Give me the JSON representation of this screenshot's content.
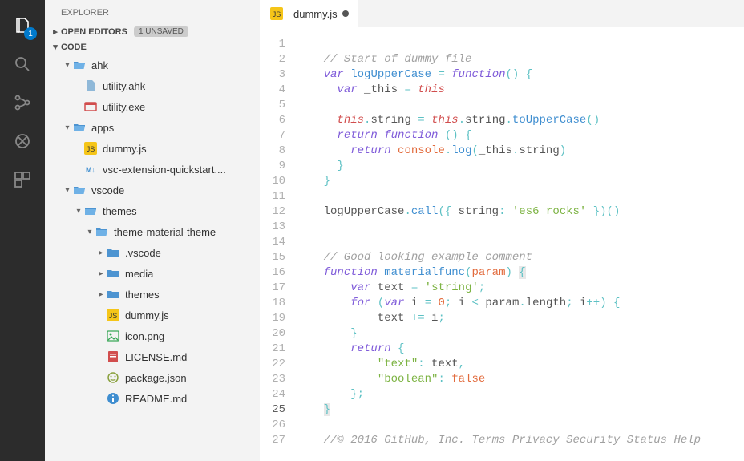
{
  "activity": {
    "badge_count": "1",
    "items": [
      "files-icon",
      "search-icon",
      "scm-icon",
      "debug-icon",
      "extensions-icon"
    ]
  },
  "sidebar": {
    "title": "EXPLORER",
    "open_editors": {
      "label": "OPEN EDITORS",
      "unsaved": "1 UNSAVED"
    },
    "root": {
      "label": "CODE"
    },
    "tree": [
      {
        "indent": 1,
        "twisty": "▾",
        "icon": "folder-open",
        "label": "ahk"
      },
      {
        "indent": 2,
        "twisty": "",
        "icon": "file",
        "label": "utility.ahk"
      },
      {
        "indent": 2,
        "twisty": "",
        "icon": "exe",
        "label": "utility.exe"
      },
      {
        "indent": 1,
        "twisty": "▾",
        "icon": "folder-open",
        "label": "apps"
      },
      {
        "indent": 2,
        "twisty": "",
        "icon": "js",
        "label": "dummy.js"
      },
      {
        "indent": 2,
        "twisty": "",
        "icon": "md-alt",
        "label": "vsc-extension-quickstart...."
      },
      {
        "indent": 1,
        "twisty": "▾",
        "icon": "folder-open",
        "label": "vscode"
      },
      {
        "indent": 2,
        "twisty": "▾",
        "icon": "folder-open",
        "label": "themes"
      },
      {
        "indent": 3,
        "twisty": "▾",
        "icon": "folder-open",
        "label": "theme-material-theme"
      },
      {
        "indent": 4,
        "twisty": "▸",
        "icon": "folder",
        "label": ".vscode"
      },
      {
        "indent": 4,
        "twisty": "▸",
        "icon": "folder",
        "label": "media"
      },
      {
        "indent": 4,
        "twisty": "▸",
        "icon": "folder",
        "label": "themes"
      },
      {
        "indent": 4,
        "twisty": "",
        "icon": "js",
        "label": "dummy.js"
      },
      {
        "indent": 4,
        "twisty": "",
        "icon": "image",
        "label": "icon.png"
      },
      {
        "indent": 4,
        "twisty": "",
        "icon": "license",
        "label": "LICENSE.md"
      },
      {
        "indent": 4,
        "twisty": "",
        "icon": "json",
        "label": "package.json"
      },
      {
        "indent": 4,
        "twisty": "",
        "icon": "info",
        "label": "README.md"
      }
    ]
  },
  "tabs": [
    {
      "icon": "js",
      "label": "dummy.js",
      "dirty": true
    }
  ],
  "code": {
    "lines": 27,
    "current_line": 25,
    "tokens": [
      [],
      [
        {
          "c": "c-comment",
          "t": "    // Start of dummy file"
        }
      ],
      [
        {
          "c": "c-norm",
          "t": "    "
        },
        {
          "c": "c-kw",
          "t": "var"
        },
        {
          "c": "c-norm",
          "t": " "
        },
        {
          "c": "c-fn",
          "t": "logUpperCase"
        },
        {
          "c": "c-norm",
          "t": " "
        },
        {
          "c": "c-op",
          "t": "="
        },
        {
          "c": "c-norm",
          "t": " "
        },
        {
          "c": "c-kw",
          "t": "function"
        },
        {
          "c": "c-punc",
          "t": "()"
        },
        {
          "c": "c-norm",
          "t": " "
        },
        {
          "c": "c-punc",
          "t": "{"
        }
      ],
      [
        {
          "c": "c-norm",
          "t": "      "
        },
        {
          "c": "c-kw",
          "t": "var"
        },
        {
          "c": "c-norm",
          "t": " _this "
        },
        {
          "c": "c-op",
          "t": "="
        },
        {
          "c": "c-norm",
          "t": " "
        },
        {
          "c": "c-this",
          "t": "this"
        }
      ],
      [],
      [
        {
          "c": "c-norm",
          "t": "      "
        },
        {
          "c": "c-this",
          "t": "this"
        },
        {
          "c": "c-punc",
          "t": "."
        },
        {
          "c": "c-id",
          "t": "string"
        },
        {
          "c": "c-norm",
          "t": " "
        },
        {
          "c": "c-op",
          "t": "="
        },
        {
          "c": "c-norm",
          "t": " "
        },
        {
          "c": "c-this",
          "t": "this"
        },
        {
          "c": "c-punc",
          "t": "."
        },
        {
          "c": "c-id",
          "t": "string"
        },
        {
          "c": "c-punc",
          "t": "."
        },
        {
          "c": "c-fn",
          "t": "toUpperCase"
        },
        {
          "c": "c-punc",
          "t": "()"
        }
      ],
      [
        {
          "c": "c-norm",
          "t": "      "
        },
        {
          "c": "c-kw",
          "t": "return"
        },
        {
          "c": "c-norm",
          "t": " "
        },
        {
          "c": "c-kw",
          "t": "function"
        },
        {
          "c": "c-norm",
          "t": " "
        },
        {
          "c": "c-punc",
          "t": "() {"
        }
      ],
      [
        {
          "c": "c-norm",
          "t": "        "
        },
        {
          "c": "c-kw",
          "t": "return"
        },
        {
          "c": "c-norm",
          "t": " "
        },
        {
          "c": "c-param",
          "t": "console"
        },
        {
          "c": "c-punc",
          "t": "."
        },
        {
          "c": "c-fn",
          "t": "log"
        },
        {
          "c": "c-punc",
          "t": "("
        },
        {
          "c": "c-id",
          "t": "_this"
        },
        {
          "c": "c-punc",
          "t": "."
        },
        {
          "c": "c-id",
          "t": "string"
        },
        {
          "c": "c-punc",
          "t": ")"
        }
      ],
      [
        {
          "c": "c-norm",
          "t": "      "
        },
        {
          "c": "c-punc",
          "t": "}"
        }
      ],
      [
        {
          "c": "c-norm",
          "t": "    "
        },
        {
          "c": "c-punc",
          "t": "}"
        }
      ],
      [],
      [
        {
          "c": "c-norm",
          "t": "    "
        },
        {
          "c": "c-id",
          "t": "logUpperCase"
        },
        {
          "c": "c-punc",
          "t": "."
        },
        {
          "c": "c-fn",
          "t": "call"
        },
        {
          "c": "c-punc",
          "t": "({ "
        },
        {
          "c": "c-id",
          "t": "string"
        },
        {
          "c": "c-punc",
          "t": ":"
        },
        {
          "c": "c-norm",
          "t": " "
        },
        {
          "c": "c-str",
          "t": "'es6 rocks'"
        },
        {
          "c": "c-norm",
          "t": " "
        },
        {
          "c": "c-punc",
          "t": "})()"
        }
      ],
      [],
      [],
      [
        {
          "c": "c-comment",
          "t": "    // Good looking example comment"
        }
      ],
      [
        {
          "c": "c-norm",
          "t": "    "
        },
        {
          "c": "c-kw",
          "t": "function"
        },
        {
          "c": "c-norm",
          "t": " "
        },
        {
          "c": "c-fn",
          "t": "materialfunc"
        },
        {
          "c": "c-punc",
          "t": "("
        },
        {
          "c": "c-param",
          "t": "param"
        },
        {
          "c": "c-punc",
          "t": ")"
        },
        {
          "c": "c-norm",
          "t": " "
        },
        {
          "c": "c-punc cursor-bg",
          "t": "{"
        }
      ],
      [
        {
          "c": "c-norm",
          "t": "        "
        },
        {
          "c": "c-kw",
          "t": "var"
        },
        {
          "c": "c-norm",
          "t": " text "
        },
        {
          "c": "c-op",
          "t": "="
        },
        {
          "c": "c-norm",
          "t": " "
        },
        {
          "c": "c-str",
          "t": "'string'"
        },
        {
          "c": "c-punc",
          "t": ";"
        }
      ],
      [
        {
          "c": "c-norm",
          "t": "        "
        },
        {
          "c": "c-kw",
          "t": "for"
        },
        {
          "c": "c-norm",
          "t": " "
        },
        {
          "c": "c-punc",
          "t": "("
        },
        {
          "c": "c-kw",
          "t": "var"
        },
        {
          "c": "c-norm",
          "t": " i "
        },
        {
          "c": "c-op",
          "t": "="
        },
        {
          "c": "c-norm",
          "t": " "
        },
        {
          "c": "c-num",
          "t": "0"
        },
        {
          "c": "c-punc",
          "t": ";"
        },
        {
          "c": "c-norm",
          "t": " i "
        },
        {
          "c": "c-op",
          "t": "<"
        },
        {
          "c": "c-norm",
          "t": " param"
        },
        {
          "c": "c-punc",
          "t": "."
        },
        {
          "c": "c-id",
          "t": "length"
        },
        {
          "c": "c-punc",
          "t": ";"
        },
        {
          "c": "c-norm",
          "t": " i"
        },
        {
          "c": "c-op",
          "t": "++"
        },
        {
          "c": "c-punc",
          "t": ") {"
        }
      ],
      [
        {
          "c": "c-norm",
          "t": "            text "
        },
        {
          "c": "c-op",
          "t": "+="
        },
        {
          "c": "c-norm",
          "t": " i"
        },
        {
          "c": "c-punc",
          "t": ";"
        }
      ],
      [
        {
          "c": "c-norm",
          "t": "        "
        },
        {
          "c": "c-punc",
          "t": "}"
        }
      ],
      [
        {
          "c": "c-norm",
          "t": "        "
        },
        {
          "c": "c-kw",
          "t": "return"
        },
        {
          "c": "c-norm",
          "t": " "
        },
        {
          "c": "c-punc",
          "t": "{"
        }
      ],
      [
        {
          "c": "c-norm",
          "t": "            "
        },
        {
          "c": "c-str",
          "t": "\"text\""
        },
        {
          "c": "c-punc",
          "t": ":"
        },
        {
          "c": "c-norm",
          "t": " text"
        },
        {
          "c": "c-punc",
          "t": ","
        }
      ],
      [
        {
          "c": "c-norm",
          "t": "            "
        },
        {
          "c": "c-str",
          "t": "\"boolean\""
        },
        {
          "c": "c-punc",
          "t": ":"
        },
        {
          "c": "c-norm",
          "t": " "
        },
        {
          "c": "c-bool",
          "t": "false"
        }
      ],
      [
        {
          "c": "c-norm",
          "t": "        "
        },
        {
          "c": "c-punc",
          "t": "};"
        }
      ],
      [
        {
          "c": "c-norm",
          "t": "    "
        },
        {
          "c": "c-punc cursor-bg",
          "t": "}"
        }
      ],
      [],
      [
        {
          "c": "c-comment",
          "t": "    //© 2016 GitHub, Inc. Terms Privacy Security Status Help"
        }
      ]
    ]
  }
}
